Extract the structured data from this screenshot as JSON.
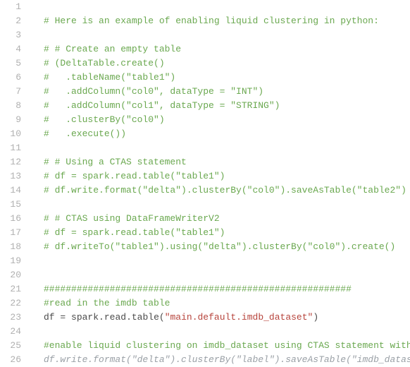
{
  "start_line": 1,
  "lines": [
    {
      "tokens": []
    },
    {
      "tokens": [
        {
          "cls": "c",
          "text": "# Here is an example of enabling liquid clustering in python:"
        }
      ]
    },
    {
      "tokens": []
    },
    {
      "tokens": [
        {
          "cls": "c",
          "text": "# # Create an empty table"
        }
      ]
    },
    {
      "tokens": [
        {
          "cls": "c",
          "text": "# (DeltaTable.create()"
        }
      ]
    },
    {
      "tokens": [
        {
          "cls": "c",
          "text": "#   .tableName(\"table1\")"
        }
      ]
    },
    {
      "tokens": [
        {
          "cls": "c",
          "text": "#   .addColumn(\"col0\", dataType = \"INT\")"
        }
      ]
    },
    {
      "tokens": [
        {
          "cls": "c",
          "text": "#   .addColumn(\"col1\", dataType = \"STRING\")"
        }
      ]
    },
    {
      "tokens": [
        {
          "cls": "c",
          "text": "#   .clusterBy(\"col0\")"
        }
      ]
    },
    {
      "tokens": [
        {
          "cls": "c",
          "text": "#   .execute())"
        }
      ]
    },
    {
      "tokens": []
    },
    {
      "tokens": [
        {
          "cls": "c",
          "text": "# # Using a CTAS statement"
        }
      ]
    },
    {
      "tokens": [
        {
          "cls": "c",
          "text": "# df = spark.read.table(\"table1\")"
        }
      ]
    },
    {
      "tokens": [
        {
          "cls": "c",
          "text": "# df.write.format(\"delta\").clusterBy(\"col0\").saveAsTable(\"table2\")"
        }
      ]
    },
    {
      "tokens": []
    },
    {
      "tokens": [
        {
          "cls": "c",
          "text": "# # CTAS using DataFrameWriterV2"
        }
      ]
    },
    {
      "tokens": [
        {
          "cls": "c",
          "text": "# df = spark.read.table(\"table1\")"
        }
      ]
    },
    {
      "tokens": [
        {
          "cls": "c",
          "text": "# df.writeTo(\"table1\").using(\"delta\").clusterBy(\"col0\").create()"
        }
      ]
    },
    {
      "tokens": []
    },
    {
      "tokens": []
    },
    {
      "tokens": [
        {
          "cls": "c",
          "text": "########################################################"
        }
      ]
    },
    {
      "tokens": [
        {
          "cls": "c",
          "text": "#read in the imdb table"
        }
      ]
    },
    {
      "tokens": [
        {
          "cls": "id",
          "text": "df "
        },
        {
          "cls": "op",
          "text": "= "
        },
        {
          "cls": "id",
          "text": "spark"
        },
        {
          "cls": "op",
          "text": "."
        },
        {
          "cls": "id",
          "text": "read"
        },
        {
          "cls": "op",
          "text": "."
        },
        {
          "cls": "fn",
          "text": "table"
        },
        {
          "cls": "op",
          "text": "("
        },
        {
          "cls": "str",
          "text": "\"main.default.imdb_dataset\""
        },
        {
          "cls": "op",
          "text": ")"
        }
      ]
    },
    {
      "tokens": []
    },
    {
      "tokens": [
        {
          "cls": "c",
          "text": "#enable liquid clustering on imdb_dataset using CTAS statement with df"
        }
      ]
    },
    {
      "tokens": [
        {
          "cls": "cg",
          "text": "df.write.format(\"delta\").clusterBy(\"label\").saveAsTable(\"imdb_dataset"
        }
      ]
    }
  ]
}
